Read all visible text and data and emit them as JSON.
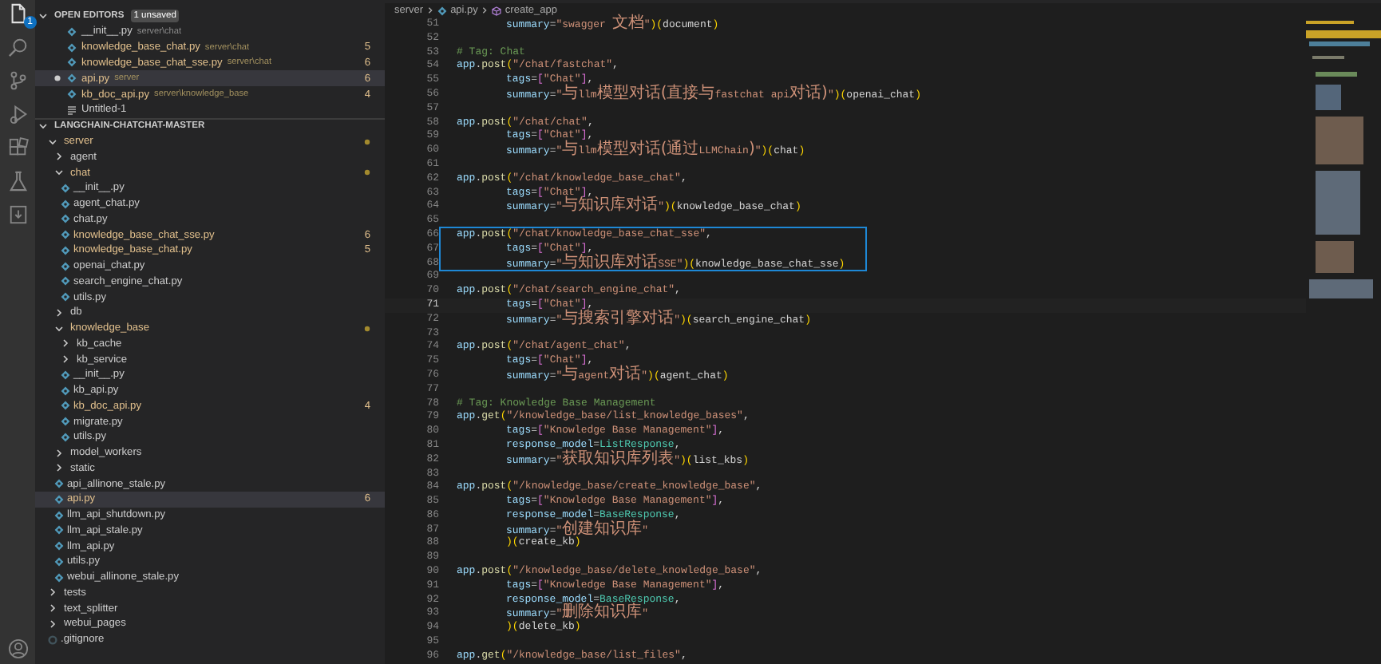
{
  "activity_bar": {
    "explorer_badge": "1"
  },
  "open_editors": {
    "title": "OPEN EDITORS",
    "expanded": true,
    "badge": "1 unsaved",
    "items": [
      {
        "name": "__init__.py",
        "path": "server\\chat",
        "kind": "python",
        "modified": false,
        "unsaved": false,
        "selected": false
      },
      {
        "name": "knowledge_base_chat.py",
        "path": "server\\chat",
        "kind": "python",
        "modified": true,
        "count": "5",
        "unsaved": false,
        "selected": false
      },
      {
        "name": "knowledge_base_chat_sse.py",
        "path": "server\\chat",
        "kind": "python",
        "modified": true,
        "count": "6",
        "unsaved": false,
        "selected": false
      },
      {
        "name": "api.py",
        "path": "server",
        "kind": "python",
        "modified": true,
        "count": "6",
        "unsaved": true,
        "selected": true
      },
      {
        "name": "kb_doc_api.py",
        "path": "server\\knowledge_base",
        "kind": "python",
        "modified": true,
        "count": "4",
        "unsaved": false,
        "selected": false
      },
      {
        "name": "Untitled-1",
        "kind": "text",
        "modified": false,
        "unsaved": false,
        "selected": false
      }
    ]
  },
  "explorer": {
    "title": "LANGCHAIN-CHATCHAT-MASTER",
    "expanded": true,
    "tree": [
      {
        "name": "server",
        "kind": "folder",
        "expanded": true,
        "modified": true,
        "selected": false,
        "children": [
          {
            "name": "agent",
            "kind": "folder",
            "expanded": false,
            "modified": false,
            "selected": false
          },
          {
            "name": "chat",
            "kind": "folder",
            "expanded": true,
            "modified": true,
            "selected": false,
            "children": [
              {
                "name": "__init__.py",
                "kind": "file",
                "modified": false,
                "selected": false
              },
              {
                "name": "agent_chat.py",
                "kind": "file",
                "modified": false,
                "selected": false
              },
              {
                "name": "chat.py",
                "kind": "file",
                "modified": false,
                "selected": false
              },
              {
                "name": "knowledge_base_chat_sse.py",
                "kind": "file",
                "modified": true,
                "count": "6",
                "selected": false
              },
              {
                "name": "knowledge_base_chat.py",
                "kind": "file",
                "modified": true,
                "count": "5",
                "selected": false
              },
              {
                "name": "openai_chat.py",
                "kind": "file",
                "modified": false,
                "selected": false
              },
              {
                "name": "search_engine_chat.py",
                "kind": "file",
                "modified": false,
                "selected": false
              },
              {
                "name": "utils.py",
                "kind": "file",
                "modified": false,
                "selected": false
              }
            ]
          },
          {
            "name": "db",
            "kind": "folder",
            "expanded": false,
            "modified": false,
            "selected": false
          },
          {
            "name": "knowledge_base",
            "kind": "folder",
            "expanded": true,
            "modified": true,
            "selected": false,
            "children": [
              {
                "name": "kb_cache",
                "kind": "folder",
                "expanded": false,
                "modified": false,
                "selected": false
              },
              {
                "name": "kb_service",
                "kind": "folder",
                "expanded": false,
                "modified": false,
                "selected": false
              },
              {
                "name": "__init__.py",
                "kind": "file",
                "modified": false,
                "selected": false
              },
              {
                "name": "kb_api.py",
                "kind": "file",
                "modified": false,
                "selected": false
              },
              {
                "name": "kb_doc_api.py",
                "kind": "file",
                "modified": true,
                "count": "4",
                "selected": false
              },
              {
                "name": "migrate.py",
                "kind": "file",
                "modified": false,
                "selected": false
              },
              {
                "name": "utils.py",
                "kind": "file",
                "modified": false,
                "selected": false
              }
            ]
          },
          {
            "name": "model_workers",
            "kind": "folder",
            "expanded": false,
            "modified": false,
            "selected": false
          },
          {
            "name": "static",
            "kind": "folder",
            "expanded": false,
            "modified": false,
            "selected": false
          },
          {
            "name": "api_allinone_stale.py",
            "kind": "file",
            "modified": false,
            "selected": false
          },
          {
            "name": "api.py",
            "kind": "file",
            "modified": true,
            "count": "6",
            "selected": true
          },
          {
            "name": "llm_api_shutdown.py",
            "kind": "file",
            "modified": false,
            "selected": false
          },
          {
            "name": "llm_api_stale.py",
            "kind": "file",
            "modified": false,
            "selected": false
          },
          {
            "name": "llm_api.py",
            "kind": "file",
            "modified": false,
            "selected": false
          },
          {
            "name": "utils.py",
            "kind": "file",
            "modified": false,
            "selected": false
          },
          {
            "name": "webui_allinone_stale.py",
            "kind": "file",
            "modified": false,
            "selected": false
          }
        ]
      },
      {
        "name": "tests",
        "kind": "folder",
        "expanded": false,
        "modified": false,
        "selected": false
      },
      {
        "name": "text_splitter",
        "kind": "folder",
        "expanded": false,
        "modified": false,
        "selected": false
      },
      {
        "name": "webui_pages",
        "kind": "folder",
        "expanded": false,
        "modified": false,
        "selected": false
      },
      {
        "name": ".gitignore",
        "kind": "config",
        "modified": false,
        "selected": false
      }
    ]
  },
  "breadcrumb": [
    {
      "text": "server",
      "kind": "folder"
    },
    {
      "text": "api.py",
      "kind": "file"
    },
    {
      "text": "create_app",
      "kind": "symbol"
    }
  ],
  "code": {
    "lines": [
      {
        "n": "51",
        "kind": "arg",
        "tokens": [
          {
            "kind": "var",
            "text": "summary"
          },
          {
            "kind": "op",
            "text": "="
          },
          {
            "kind": "str",
            "text": "\"swagger "
          },
          {
            "kind": "cjk",
            "text": "文档"
          },
          {
            "kind": "str",
            "text": "\""
          },
          {
            "kind": "paren",
            "text": ")("
          },
          {
            "kind": "plain",
            "text": "document"
          },
          {
            "kind": "paren",
            "text": ")"
          }
        ]
      },
      {
        "n": "52"
      },
      {
        "n": "53",
        "kind": "top",
        "tokens": [
          {
            "kind": "cmt",
            "text": "# Tag: Chat"
          }
        ]
      },
      {
        "n": "54",
        "kind": "top",
        "tokens": [
          {
            "kind": "var",
            "text": "app"
          },
          {
            "kind": "op",
            "text": "."
          },
          {
            "kind": "fn",
            "text": "post"
          },
          {
            "kind": "paren",
            "text": "("
          },
          {
            "kind": "str",
            "text": "\"/chat/fastchat\""
          },
          {
            "kind": "op",
            "text": ","
          }
        ]
      },
      {
        "n": "55",
        "kind": "arg",
        "tokens": [
          {
            "kind": "var",
            "text": "tags"
          },
          {
            "kind": "op",
            "text": "="
          },
          {
            "kind": "brack",
            "text": "["
          },
          {
            "kind": "str",
            "text": "\"Chat\""
          },
          {
            "kind": "brack",
            "text": "]"
          },
          {
            "kind": "op",
            "text": ","
          }
        ]
      },
      {
        "n": "56",
        "kind": "arg",
        "tokens": [
          {
            "kind": "var",
            "text": "summary"
          },
          {
            "kind": "op",
            "text": "="
          },
          {
            "kind": "str",
            "text": "\""
          },
          {
            "kind": "cjk",
            "text": "与"
          },
          {
            "kind": "str",
            "text": "llm"
          },
          {
            "kind": "cjk",
            "text": "模型对话(直接与"
          },
          {
            "kind": "str",
            "text": "fastchat api"
          },
          {
            "kind": "cjk",
            "text": "对话)"
          },
          {
            "kind": "str",
            "text": "\""
          },
          {
            "kind": "paren",
            "text": ")("
          },
          {
            "kind": "plain",
            "text": "openai_chat"
          },
          {
            "kind": "paren",
            "text": ")"
          }
        ]
      },
      {
        "n": "57"
      },
      {
        "n": "58",
        "kind": "top",
        "tokens": [
          {
            "kind": "var",
            "text": "app"
          },
          {
            "kind": "op",
            "text": "."
          },
          {
            "kind": "fn",
            "text": "post"
          },
          {
            "kind": "paren",
            "text": "("
          },
          {
            "kind": "str",
            "text": "\"/chat/chat\""
          },
          {
            "kind": "op",
            "text": ","
          }
        ]
      },
      {
        "n": "59",
        "kind": "arg",
        "tokens": [
          {
            "kind": "var",
            "text": "tags"
          },
          {
            "kind": "op",
            "text": "="
          },
          {
            "kind": "brack",
            "text": "["
          },
          {
            "kind": "str",
            "text": "\"Chat\""
          },
          {
            "kind": "brack",
            "text": "]"
          },
          {
            "kind": "op",
            "text": ","
          }
        ]
      },
      {
        "n": "60",
        "kind": "arg",
        "tokens": [
          {
            "kind": "var",
            "text": "summary"
          },
          {
            "kind": "op",
            "text": "="
          },
          {
            "kind": "str",
            "text": "\""
          },
          {
            "kind": "cjk",
            "text": "与"
          },
          {
            "kind": "str",
            "text": "llm"
          },
          {
            "kind": "cjk",
            "text": "模型对话(通过"
          },
          {
            "kind": "str",
            "text": "LLMChain"
          },
          {
            "kind": "cjk",
            "text": ")"
          },
          {
            "kind": "str",
            "text": "\""
          },
          {
            "kind": "paren",
            "text": ")("
          },
          {
            "kind": "plain",
            "text": "chat"
          },
          {
            "kind": "paren",
            "text": ")"
          }
        ]
      },
      {
        "n": "61"
      },
      {
        "n": "62",
        "kind": "top",
        "tokens": [
          {
            "kind": "var",
            "text": "app"
          },
          {
            "kind": "op",
            "text": "."
          },
          {
            "kind": "fn",
            "text": "post"
          },
          {
            "kind": "paren",
            "text": "("
          },
          {
            "kind": "str",
            "text": "\"/chat/knowledge_base_chat\""
          },
          {
            "kind": "op",
            "text": ","
          }
        ]
      },
      {
        "n": "63",
        "kind": "arg",
        "tokens": [
          {
            "kind": "var",
            "text": "tags"
          },
          {
            "kind": "op",
            "text": "="
          },
          {
            "kind": "brack",
            "text": "["
          },
          {
            "kind": "str",
            "text": "\"Chat\""
          },
          {
            "kind": "brack",
            "text": "]"
          },
          {
            "kind": "op",
            "text": ","
          }
        ]
      },
      {
        "n": "64",
        "kind": "arg",
        "tokens": [
          {
            "kind": "var",
            "text": "summary"
          },
          {
            "kind": "op",
            "text": "="
          },
          {
            "kind": "str",
            "text": "\""
          },
          {
            "kind": "cjk",
            "text": "与知识库对话"
          },
          {
            "kind": "str",
            "text": "\""
          },
          {
            "kind": "paren",
            "text": ")("
          },
          {
            "kind": "plain",
            "text": "knowledge_base_chat"
          },
          {
            "kind": "paren",
            "text": ")"
          }
        ]
      },
      {
        "n": "65"
      },
      {
        "n": "66",
        "kind": "top",
        "highlighted": true,
        "tokens": [
          {
            "kind": "var",
            "text": "app"
          },
          {
            "kind": "op",
            "text": "."
          },
          {
            "kind": "fn",
            "text": "post"
          },
          {
            "kind": "paren",
            "text": "("
          },
          {
            "kind": "str",
            "text": "\"/chat/knowledge_base_chat_sse\""
          },
          {
            "kind": "op",
            "text": ","
          }
        ]
      },
      {
        "n": "67",
        "kind": "arg",
        "highlighted": true,
        "tokens": [
          {
            "kind": "var",
            "text": "tags"
          },
          {
            "kind": "op",
            "text": "="
          },
          {
            "kind": "brack",
            "text": "["
          },
          {
            "kind": "str",
            "text": "\"Chat\""
          },
          {
            "kind": "brack",
            "text": "]"
          },
          {
            "kind": "op",
            "text": ","
          }
        ]
      },
      {
        "n": "68",
        "kind": "arg",
        "highlighted": true,
        "tokens": [
          {
            "kind": "var",
            "text": "summary"
          },
          {
            "kind": "op",
            "text": "="
          },
          {
            "kind": "str",
            "text": "\""
          },
          {
            "kind": "cjk",
            "text": "与知识库对话"
          },
          {
            "kind": "str",
            "text": "SSE\""
          },
          {
            "kind": "paren",
            "text": ")("
          },
          {
            "kind": "plain",
            "text": "knowledge_base_chat_sse"
          },
          {
            "kind": "paren",
            "text": ")"
          }
        ]
      },
      {
        "n": "69"
      },
      {
        "n": "70",
        "kind": "top",
        "tokens": [
          {
            "kind": "var",
            "text": "app"
          },
          {
            "kind": "op",
            "text": "."
          },
          {
            "kind": "fn",
            "text": "post"
          },
          {
            "kind": "paren",
            "text": "("
          },
          {
            "kind": "str",
            "text": "\"/chat/search_engine_chat\""
          },
          {
            "kind": "op",
            "text": ","
          }
        ]
      },
      {
        "n": "71",
        "kind": "arg",
        "current": true,
        "tokens": [
          {
            "kind": "var",
            "text": "tags"
          },
          {
            "kind": "op",
            "text": "="
          },
          {
            "kind": "brack",
            "text": "["
          },
          {
            "kind": "str",
            "text": "\"Chat\""
          },
          {
            "kind": "brack",
            "text": "]"
          },
          {
            "kind": "op",
            "text": ","
          }
        ]
      },
      {
        "n": "72",
        "kind": "arg",
        "tokens": [
          {
            "kind": "var",
            "text": "summary"
          },
          {
            "kind": "op",
            "text": "="
          },
          {
            "kind": "str",
            "text": "\""
          },
          {
            "kind": "cjk",
            "text": "与搜索引擎对话"
          },
          {
            "kind": "str",
            "text": "\""
          },
          {
            "kind": "paren",
            "text": ")("
          },
          {
            "kind": "plain",
            "text": "search_engine_chat"
          },
          {
            "kind": "paren",
            "text": ")"
          }
        ]
      },
      {
        "n": "73"
      },
      {
        "n": "74",
        "kind": "top",
        "tokens": [
          {
            "kind": "var",
            "text": "app"
          },
          {
            "kind": "op",
            "text": "."
          },
          {
            "kind": "fn",
            "text": "post"
          },
          {
            "kind": "paren",
            "text": "("
          },
          {
            "kind": "str",
            "text": "\"/chat/agent_chat\""
          },
          {
            "kind": "op",
            "text": ","
          }
        ]
      },
      {
        "n": "75",
        "kind": "arg",
        "tokens": [
          {
            "kind": "var",
            "text": "tags"
          },
          {
            "kind": "op",
            "text": "="
          },
          {
            "kind": "brack",
            "text": "["
          },
          {
            "kind": "str",
            "text": "\"Chat\""
          },
          {
            "kind": "brack",
            "text": "]"
          },
          {
            "kind": "op",
            "text": ","
          }
        ]
      },
      {
        "n": "76",
        "kind": "arg",
        "tokens": [
          {
            "kind": "var",
            "text": "summary"
          },
          {
            "kind": "op",
            "text": "="
          },
          {
            "kind": "str",
            "text": "\""
          },
          {
            "kind": "cjk",
            "text": "与"
          },
          {
            "kind": "str",
            "text": "agent"
          },
          {
            "kind": "cjk",
            "text": "对话"
          },
          {
            "kind": "str",
            "text": "\""
          },
          {
            "kind": "paren",
            "text": ")("
          },
          {
            "kind": "plain",
            "text": "agent_chat"
          },
          {
            "kind": "paren",
            "text": ")"
          }
        ]
      },
      {
        "n": "77"
      },
      {
        "n": "78",
        "kind": "top",
        "tokens": [
          {
            "kind": "cmt",
            "text": "# Tag: Knowledge Base Management"
          }
        ]
      },
      {
        "n": "79",
        "kind": "top",
        "tokens": [
          {
            "kind": "var",
            "text": "app"
          },
          {
            "kind": "op",
            "text": "."
          },
          {
            "kind": "fn",
            "text": "get"
          },
          {
            "kind": "paren",
            "text": "("
          },
          {
            "kind": "str",
            "text": "\"/knowledge_base/list_knowledge_bases\""
          },
          {
            "kind": "op",
            "text": ","
          }
        ]
      },
      {
        "n": "80",
        "kind": "arg",
        "tokens": [
          {
            "kind": "var",
            "text": "tags"
          },
          {
            "kind": "op",
            "text": "="
          },
          {
            "kind": "brack",
            "text": "["
          },
          {
            "kind": "str",
            "text": "\"Knowledge Base Management\""
          },
          {
            "kind": "brack",
            "text": "]"
          },
          {
            "kind": "op",
            "text": ","
          }
        ]
      },
      {
        "n": "81",
        "kind": "arg",
        "tokens": [
          {
            "kind": "var",
            "text": "response_model"
          },
          {
            "kind": "op",
            "text": "="
          },
          {
            "kind": "cls",
            "text": "ListResponse"
          },
          {
            "kind": "op",
            "text": ","
          }
        ]
      },
      {
        "n": "82",
        "kind": "arg",
        "tokens": [
          {
            "kind": "var",
            "text": "summary"
          },
          {
            "kind": "op",
            "text": "="
          },
          {
            "kind": "str",
            "text": "\""
          },
          {
            "kind": "cjk",
            "text": "获取知识库列表"
          },
          {
            "kind": "str",
            "text": "\""
          },
          {
            "kind": "paren",
            "text": ")("
          },
          {
            "kind": "plain",
            "text": "list_kbs"
          },
          {
            "kind": "paren",
            "text": ")"
          }
        ]
      },
      {
        "n": "83"
      },
      {
        "n": "84",
        "kind": "top",
        "tokens": [
          {
            "kind": "var",
            "text": "app"
          },
          {
            "kind": "op",
            "text": "."
          },
          {
            "kind": "fn",
            "text": "post"
          },
          {
            "kind": "paren",
            "text": "("
          },
          {
            "kind": "str",
            "text": "\"/knowledge_base/create_knowledge_base\""
          },
          {
            "kind": "op",
            "text": ","
          }
        ]
      },
      {
        "n": "85",
        "kind": "arg",
        "tokens": [
          {
            "kind": "var",
            "text": "tags"
          },
          {
            "kind": "op",
            "text": "="
          },
          {
            "kind": "brack",
            "text": "["
          },
          {
            "kind": "str",
            "text": "\"Knowledge Base Management\""
          },
          {
            "kind": "brack",
            "text": "]"
          },
          {
            "kind": "op",
            "text": ","
          }
        ]
      },
      {
        "n": "86",
        "kind": "arg",
        "tokens": [
          {
            "kind": "var",
            "text": "response_model"
          },
          {
            "kind": "op",
            "text": "="
          },
          {
            "kind": "cls",
            "text": "BaseResponse"
          },
          {
            "kind": "op",
            "text": ","
          }
        ]
      },
      {
        "n": "87",
        "kind": "arg",
        "tokens": [
          {
            "kind": "var",
            "text": "summary"
          },
          {
            "kind": "op",
            "text": "="
          },
          {
            "kind": "str",
            "text": "\""
          },
          {
            "kind": "cjk",
            "text": "创建知识库"
          },
          {
            "kind": "str",
            "text": "\""
          }
        ]
      },
      {
        "n": "88",
        "kind": "arg",
        "tokens": [
          {
            "kind": "paren",
            "text": ")("
          },
          {
            "kind": "plain",
            "text": "create_kb"
          },
          {
            "kind": "paren",
            "text": ")"
          }
        ]
      },
      {
        "n": "89"
      },
      {
        "n": "90",
        "kind": "top",
        "tokens": [
          {
            "kind": "var",
            "text": "app"
          },
          {
            "kind": "op",
            "text": "."
          },
          {
            "kind": "fn",
            "text": "post"
          },
          {
            "kind": "paren",
            "text": "("
          },
          {
            "kind": "str",
            "text": "\"/knowledge_base/delete_knowledge_base\""
          },
          {
            "kind": "op",
            "text": ","
          }
        ]
      },
      {
        "n": "91",
        "kind": "arg",
        "tokens": [
          {
            "kind": "var",
            "text": "tags"
          },
          {
            "kind": "op",
            "text": "="
          },
          {
            "kind": "brack",
            "text": "["
          },
          {
            "kind": "str",
            "text": "\"Knowledge Base Management\""
          },
          {
            "kind": "brack",
            "text": "]"
          },
          {
            "kind": "op",
            "text": ","
          }
        ]
      },
      {
        "n": "92",
        "kind": "arg",
        "tokens": [
          {
            "kind": "var",
            "text": "response_model"
          },
          {
            "kind": "op",
            "text": "="
          },
          {
            "kind": "cls",
            "text": "BaseResponse"
          },
          {
            "kind": "op",
            "text": ","
          }
        ]
      },
      {
        "n": "93",
        "kind": "arg",
        "tokens": [
          {
            "kind": "var",
            "text": "summary"
          },
          {
            "kind": "op",
            "text": "="
          },
          {
            "kind": "str",
            "text": "\""
          },
          {
            "kind": "cjk",
            "text": "删除知识库"
          },
          {
            "kind": "str",
            "text": "\""
          }
        ]
      },
      {
        "n": "94",
        "kind": "arg",
        "tokens": [
          {
            "kind": "paren",
            "text": ")("
          },
          {
            "kind": "plain",
            "text": "delete_kb"
          },
          {
            "kind": "paren",
            "text": ")"
          }
        ]
      },
      {
        "n": "95"
      },
      {
        "n": "96",
        "kind": "top",
        "tokens": [
          {
            "kind": "var",
            "text": "app"
          },
          {
            "kind": "op",
            "text": "."
          },
          {
            "kind": "fn",
            "text": "get"
          },
          {
            "kind": "paren",
            "text": "("
          },
          {
            "kind": "str",
            "text": "\"/knowledge_base/list_files\""
          },
          {
            "kind": "op",
            "text": ","
          }
        ]
      }
    ]
  }
}
